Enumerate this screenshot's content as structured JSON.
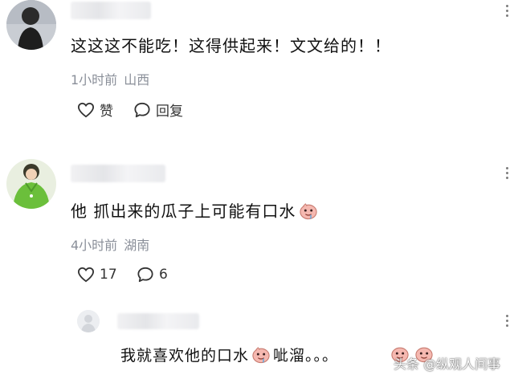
{
  "comments": [
    {
      "text": "这这这不能吃！这得供起来！文文给的！！",
      "time": "1小时前",
      "location": "山西",
      "like_label": "赞",
      "reply_label": "回复"
    },
    {
      "text": "他 抓出来的瓜子上可能有口水",
      "time": "4小时前",
      "location": "湖南",
      "like_count": "17",
      "reply_count": "6"
    }
  ],
  "reply": {
    "text_a": "我就喜欢他的口水",
    "text_b": "呲溜。。。"
  },
  "watermark": "头条 @纵观人间事",
  "icons": {
    "like": "heart-outline-icon",
    "reply": "speech-bubble-icon",
    "more": "more-vertical-icon",
    "emoji": "drooling-emoji"
  }
}
